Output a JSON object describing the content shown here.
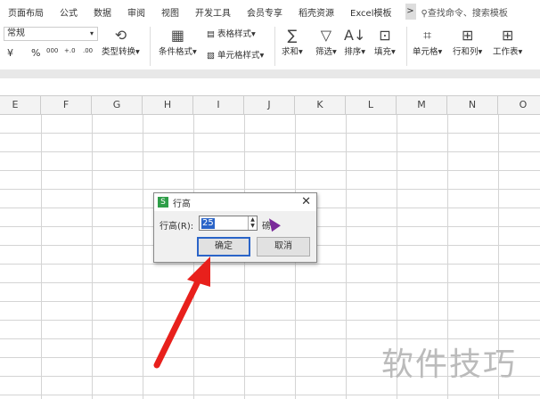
{
  "tabs": [
    "页面布局",
    "公式",
    "数据",
    "审阅",
    "视图",
    "开发工具",
    "会员专享",
    "稻壳资源",
    "Excel模板"
  ],
  "more": ">",
  "search": "查找命令、搜索模板",
  "ribbon": {
    "number_format": "常规",
    "currency": "¥",
    "percent": "%",
    "thousands": "000",
    "inc_decimal": "+.0",
    "dec_decimal": ".00",
    "type_convert": "类型转换",
    "cond_format": "条件格式",
    "table_style": "表格样式",
    "cell_style": "单元格样式",
    "sum": "求和",
    "filter": "筛选",
    "sort": "排序",
    "fill": "填充",
    "cell": "单元格",
    "row_col": "行和列",
    "sheet": "工作表"
  },
  "columns": [
    "E",
    "F",
    "G",
    "H",
    "I",
    "J",
    "K",
    "L",
    "M",
    "N",
    "O"
  ],
  "dialog": {
    "title": "行高",
    "label": "行高(R):",
    "value": "25",
    "unit": "磅",
    "ok": "确定",
    "cancel": "取消"
  },
  "watermark": "软件技巧"
}
